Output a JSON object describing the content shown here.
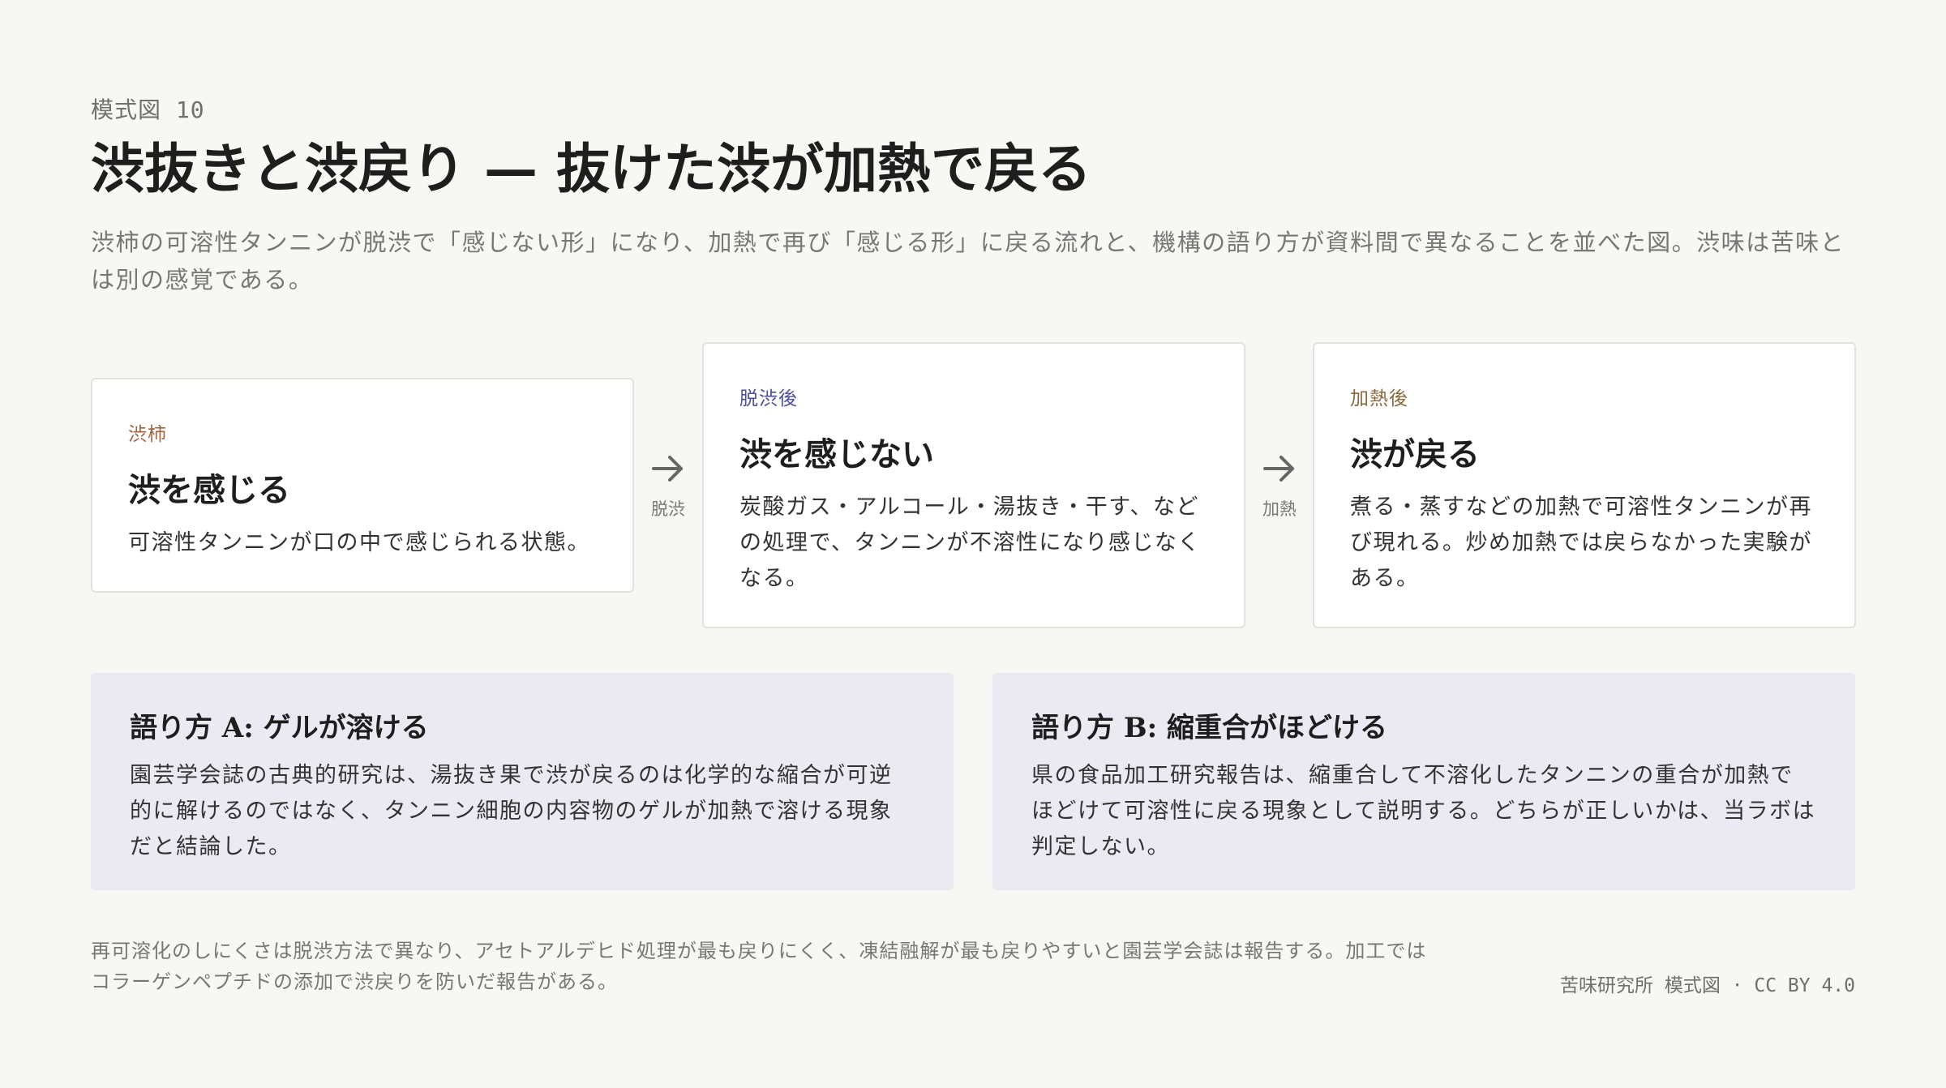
{
  "header": {
    "label": "模式図 10",
    "title": "渋抜きと渋戻り — 抜けた渋が加熱で戻る",
    "subtitle": "渋柿の可溶性タンニンが脱渋で「感じない形」になり、加熱で再び「感じる形」に戻る流れと、機構の語り方が資料間で異なることを並べた図。渋味は苦味とは別の感覚である。"
  },
  "stages": [
    {
      "tag": "渋柿",
      "title": "渋を感じる",
      "text": "可溶性タンニンが口の中で感じられる状態。",
      "tag_color": "#a0673f"
    },
    {
      "tag": "脱渋後",
      "title": "渋を感じない",
      "text": "炭酸ガス・アルコール・湯抜き・干す、などの処理で、タンニンが不溶性になり感じなくなる。",
      "tag_color": "#4b4f9a"
    },
    {
      "tag": "加熱後",
      "title": "渋が戻る",
      "text": "煮る・蒸すなどの加熱で可溶性タンニンが再び現れる。炒め加熱では戻らなかった実験がある。",
      "tag_color": "#8a6a3c"
    }
  ],
  "arrows": [
    {
      "label": "脱渋"
    },
    {
      "label": "加熱"
    }
  ],
  "claims": [
    {
      "title": "語り方 A: ゲルが溶ける",
      "text": "園芸学会誌の古典的研究は、湯抜き果で渋が戻るのは化学的な縮合が可逆的に解けるのではなく、タンニン細胞の内容物のゲルが加熱で溶ける現象だと結論した。"
    },
    {
      "title": "語り方 B: 縮重合がほどける",
      "text": "県の食品加工研究報告は、縮重合して不溶化したタンニンの重合が加熱でほどけて可溶性に戻る現象として説明する。どちらが正しいかは、当ラボは判定しない。"
    }
  ],
  "footer": {
    "note": "再可溶化のしにくさは脱渋方法で異なり、アセトアルデヒド処理が最も戻りにくく、凍結融解が最も戻りやすいと園芸学会誌は報告する。加工ではコラーゲンペプチドの添加で渋戻りを防いだ報告がある。",
    "credit": "苦味研究所 模式図 · CC BY 4.0"
  }
}
